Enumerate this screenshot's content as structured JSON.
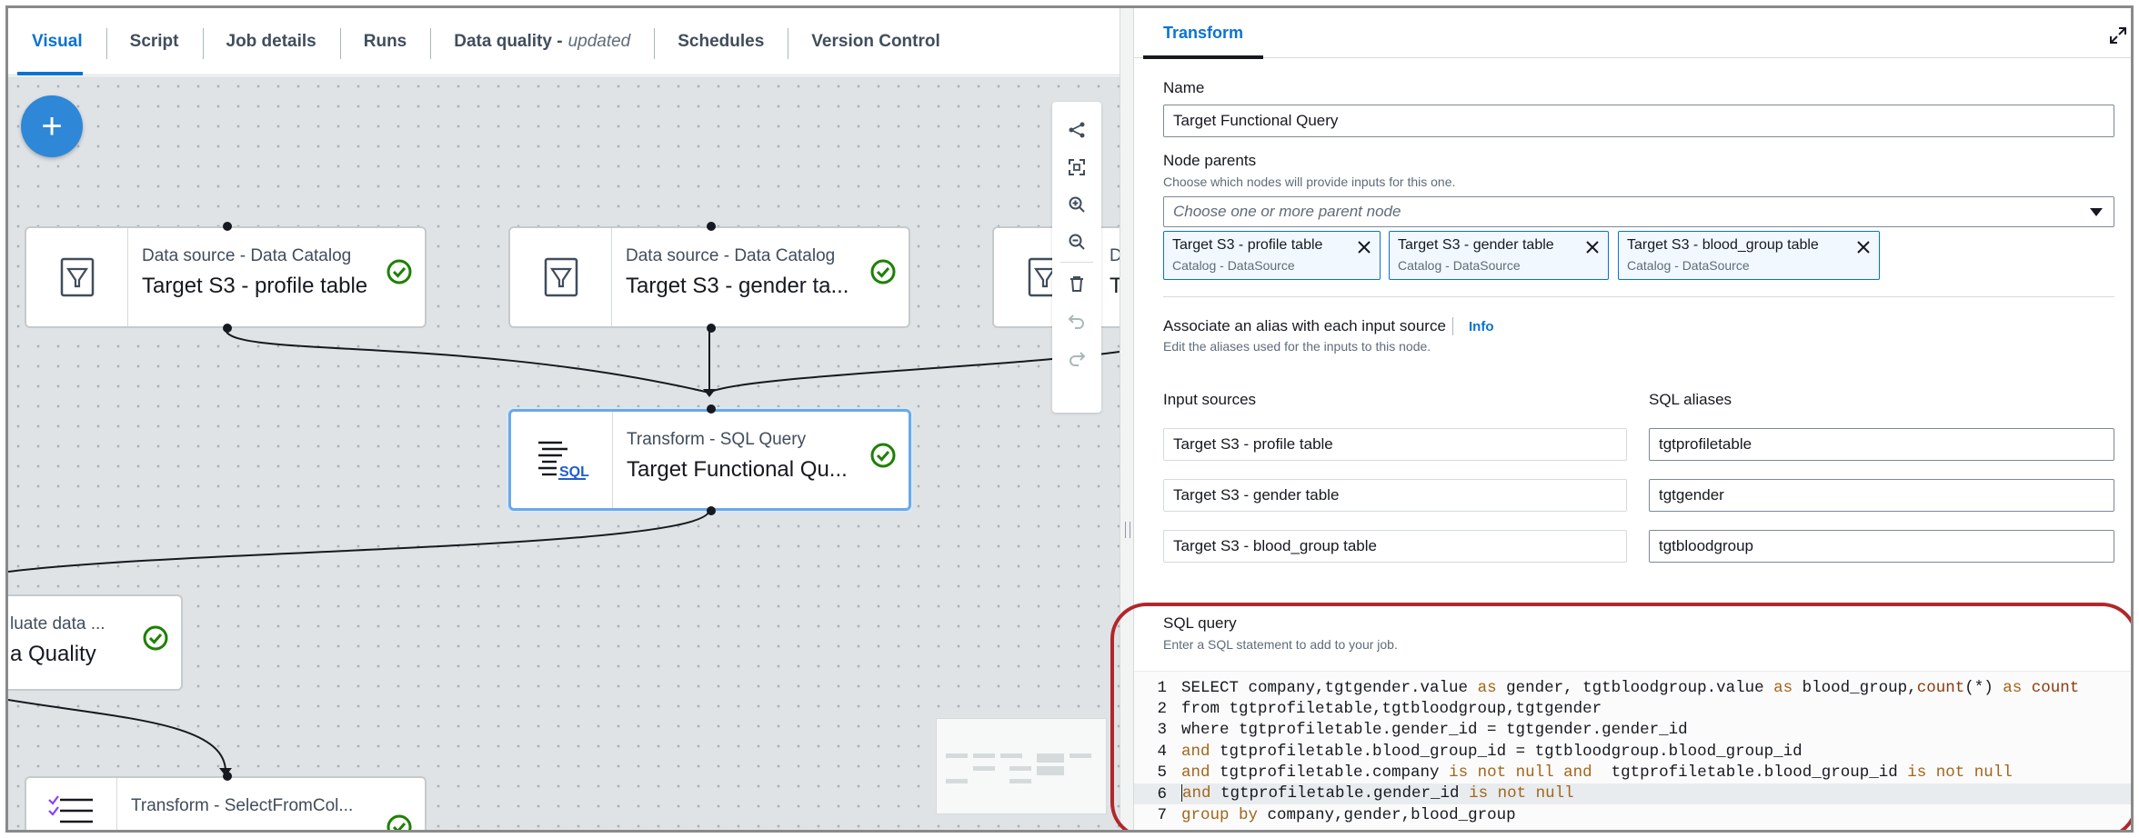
{
  "tabs": [
    {
      "label": "Visual"
    },
    {
      "label": "Script"
    },
    {
      "label": "Job details"
    },
    {
      "label": "Runs"
    },
    {
      "label": "Data quality -",
      "suffix": "updated"
    },
    {
      "label": "Schedules"
    },
    {
      "label": "Version Control"
    }
  ],
  "canvas": {
    "add_symbol": "+",
    "nodes": [
      {
        "type": "Data source - Data Catalog",
        "name": "Target S3 - profile table",
        "icon": "catalog-icon"
      },
      {
        "type": "Data source - Data Catalog",
        "name": "Target S3 - gender ta...",
        "icon": "catalog-icon"
      },
      {
        "type": "D",
        "name": "T",
        "icon": "catalog-icon"
      },
      {
        "type": "Transform - SQL Query",
        "name": "Target Functional Qu...",
        "icon": "sql-icon",
        "icon_text": "SQL"
      },
      {
        "type": "luate data ...",
        "name": "a Quality",
        "icon": "quality-icon"
      },
      {
        "type": "Transform - SelectFromCol...",
        "name": "",
        "icon": "select-icon"
      }
    ]
  },
  "panel": {
    "tab": "Transform",
    "name_label": "Name",
    "name_value": "Target Functional Query",
    "parents_label": "Node parents",
    "parents_desc": "Choose which nodes will provide inputs for this one.",
    "parents_placeholder": "Choose one or more parent node",
    "tokens": [
      {
        "label": "Target S3 - profile table",
        "sub": "Catalog - DataSource"
      },
      {
        "label": "Target S3 - gender table",
        "sub": "Catalog - DataSource"
      },
      {
        "label": "Target S3 - blood_group table",
        "sub": "Catalog - DataSource"
      }
    ],
    "alias_label": "Associate an alias with each input source",
    "alias_info": "Info",
    "alias_desc": "Edit the aliases used for the inputs to this node.",
    "input_sources_label": "Input sources",
    "sql_aliases_label": "SQL aliases",
    "rows": [
      {
        "source": "Target S3  - profile table",
        "alias": "tgtprofiletable"
      },
      {
        "source": "Target S3  - gender table",
        "alias": "tgtgender"
      },
      {
        "source": "Target S3  - blood_group table",
        "alias": "tgtbloodgroup"
      }
    ],
    "sql_label": "SQL query",
    "sql_desc": "Enter a SQL statement to add to your job.",
    "sql_lines": [
      "SELECT company,tgtgender.value as gender, tgtbloodgroup.value as blood_group,count(*) as count",
      "from tgtprofiletable,tgtbloodgroup,tgtgender",
      "where tgtprofiletable.gender_id = tgtgender.gender_id",
      "and tgtprofiletable.blood_group_id = tgtbloodgroup.blood_group_id",
      "and tgtprofiletable.company is not null and  tgtprofiletable.blood_group_id is not null",
      "and tgtprofiletable.gender_id is not null",
      "group by company,gender,blood_group"
    ],
    "active_line": 6
  },
  "colors": {
    "accent": "#0972d3",
    "success": "#1d8102",
    "highlight": "#b0282a"
  }
}
